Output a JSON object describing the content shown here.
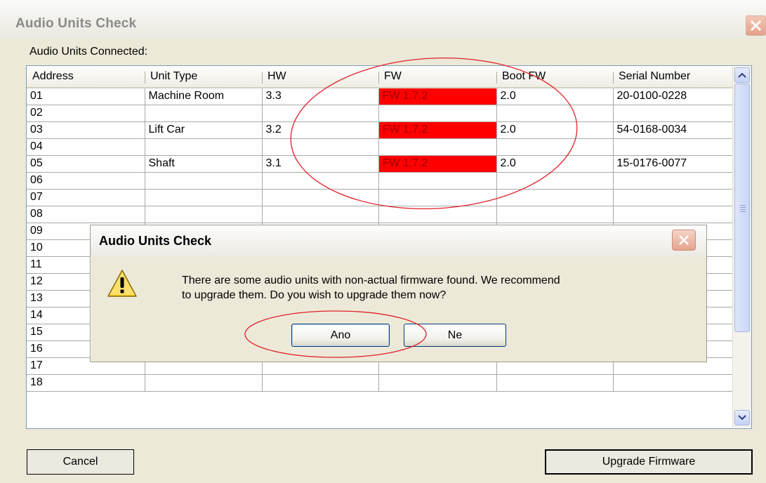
{
  "window": {
    "title": "Audio Units Check",
    "group_label": "Audio Units Connected:"
  },
  "grid": {
    "columns": [
      "Address",
      "Unit Type",
      "HW",
      "FW",
      "Boot FW",
      "Serial Number"
    ],
    "rows": [
      {
        "address": "01",
        "unit_type": "Machine Room",
        "hw": "3.3",
        "fw": "FW 1.7.2",
        "boot_fw": "2.0",
        "serial": "20-0100-0228"
      },
      {
        "address": "02",
        "unit_type": "",
        "hw": "",
        "fw": "",
        "boot_fw": "",
        "serial": ""
      },
      {
        "address": "03",
        "unit_type": "Lift Car",
        "hw": "3.2",
        "fw": "FW 1.7.2",
        "boot_fw": "2.0",
        "serial": "54-0168-0034"
      },
      {
        "address": "04",
        "unit_type": "",
        "hw": "",
        "fw": "",
        "boot_fw": "",
        "serial": ""
      },
      {
        "address": "05",
        "unit_type": "Shaft",
        "hw": "3.1",
        "fw": "FW 1.7.2",
        "boot_fw": "2.0",
        "serial": "15-0176-0077"
      },
      {
        "address": "06",
        "unit_type": "",
        "hw": "",
        "fw": "",
        "boot_fw": "",
        "serial": ""
      },
      {
        "address": "07",
        "unit_type": "",
        "hw": "",
        "fw": "",
        "boot_fw": "",
        "serial": ""
      },
      {
        "address": "08",
        "unit_type": "",
        "hw": "",
        "fw": "",
        "boot_fw": "",
        "serial": ""
      },
      {
        "address": "09",
        "unit_type": "",
        "hw": "",
        "fw": "",
        "boot_fw": "",
        "serial": ""
      },
      {
        "address": "10",
        "unit_type": "",
        "hw": "",
        "fw": "",
        "boot_fw": "",
        "serial": ""
      },
      {
        "address": "11",
        "unit_type": "",
        "hw": "",
        "fw": "",
        "boot_fw": "",
        "serial": ""
      },
      {
        "address": "12",
        "unit_type": "",
        "hw": "",
        "fw": "",
        "boot_fw": "",
        "serial": ""
      },
      {
        "address": "13",
        "unit_type": "",
        "hw": "",
        "fw": "",
        "boot_fw": "",
        "serial": ""
      },
      {
        "address": "14",
        "unit_type": "",
        "hw": "",
        "fw": "",
        "boot_fw": "",
        "serial": ""
      },
      {
        "address": "15",
        "unit_type": "",
        "hw": "",
        "fw": "",
        "boot_fw": "",
        "serial": ""
      },
      {
        "address": "16",
        "unit_type": "",
        "hw": "",
        "fw": "",
        "boot_fw": "",
        "serial": ""
      },
      {
        "address": "17",
        "unit_type": "",
        "hw": "",
        "fw": "",
        "boot_fw": "",
        "serial": ""
      },
      {
        "address": "18",
        "unit_type": "",
        "hw": "",
        "fw": "",
        "boot_fw": "",
        "serial": ""
      }
    ],
    "outdated_fw_color": "#ff0000"
  },
  "buttons": {
    "cancel": "Cancel",
    "upgrade": "Upgrade Firmware"
  },
  "dialog": {
    "title": "Audio Units Check",
    "message_line1": "There are some audio units with non-actual firmware found. We recommend",
    "message_line2": "to upgrade them. Do you wish to upgrade them now?",
    "yes_label": "Ano",
    "no_label": "Ne",
    "icon": "warning-icon"
  },
  "annotation_color": "#e0202a"
}
